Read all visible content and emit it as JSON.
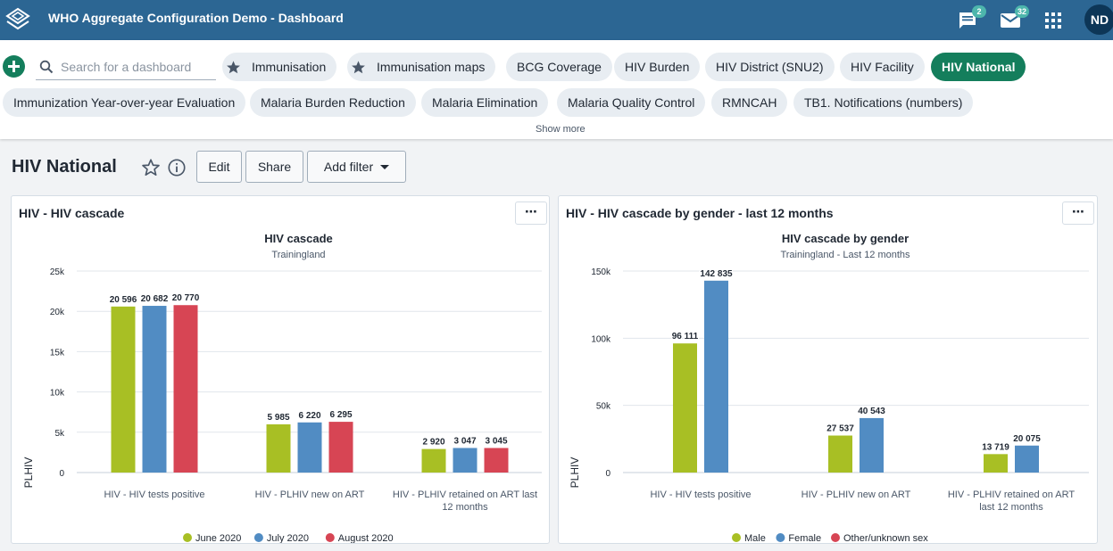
{
  "app": {
    "title": "WHO Aggregate Configuration Demo - Dashboard",
    "logo_icon": "dhis2-logo-icon",
    "interpretations_badge": "2",
    "messages_badge": "32",
    "user_initials": "ND",
    "colors": {
      "header": "#2c6693",
      "accent": "#147e5c",
      "badge": "#4db6ac"
    }
  },
  "dashboards": {
    "search_placeholder": "Search for a dashboard",
    "items": [
      {
        "label": "Immunisation",
        "starred": true
      },
      {
        "label": "Immunisation maps",
        "starred": true
      },
      {
        "label": "BCG Coverage",
        "starred": false
      },
      {
        "label": "HIV Burden",
        "starred": false
      },
      {
        "label": "HIV District (SNU2)",
        "starred": false
      },
      {
        "label": "HIV Facility",
        "starred": false
      },
      {
        "label": "HIV National",
        "starred": false,
        "selected": true
      },
      {
        "label": "Immunization Year-over-year Evaluation",
        "starred": false
      },
      {
        "label": "Malaria Burden Reduction",
        "starred": false
      },
      {
        "label": "Malaria Elimination",
        "starred": false
      },
      {
        "label": "Malaria Quality Control",
        "starred": false
      },
      {
        "label": "RMNCAH",
        "starred": false
      },
      {
        "label": "TB1. Notifications (numbers)",
        "starred": false
      }
    ],
    "show_more": "Show more"
  },
  "dashboard": {
    "title": "HIV National",
    "edit_label": "Edit",
    "share_label": "Share",
    "add_filter_label": "Add filter"
  },
  "panels": [
    {
      "title": "HIV - HIV cascade",
      "menu_label": "⋯"
    },
    {
      "title": "HIV - HIV cascade by gender - last 12 months",
      "menu_label": "⋯"
    }
  ],
  "chart_data": [
    {
      "type": "bar",
      "title": "HIV cascade",
      "subtitle": "Trainingland",
      "xlabel": "",
      "ylabel": "PLHIV",
      "ylim": [
        0,
        25000
      ],
      "yticks": [
        "0",
        "5k",
        "10k",
        "15k",
        "20k",
        "25k"
      ],
      "categories": [
        "HIV - HIV tests positive",
        "HIV - PLHIV new on ART",
        "HIV - PLHIV retained on ART last 12 months"
      ],
      "series": [
        {
          "name": "June 2020",
          "color": "#a8bf24",
          "values": [
            20596,
            5985,
            2920
          ],
          "labels": [
            "20 596",
            "5 985",
            "2 920"
          ]
        },
        {
          "name": "July 2020",
          "color": "#518cc3",
          "values": [
            20682,
            6220,
            3047
          ],
          "labels": [
            "20 682",
            "6 220",
            "3 047"
          ]
        },
        {
          "name": "August 2020",
          "color": "#d74554",
          "values": [
            20770,
            6295,
            3045
          ],
          "labels": [
            "20 770",
            "6 295",
            "3 045"
          ]
        }
      ],
      "grid": true,
      "legend": "bottom-center"
    },
    {
      "type": "bar",
      "title": "HIV cascade by gender",
      "subtitle": "Trainingland - Last 12 months",
      "xlabel": "",
      "ylabel": "PLHIV",
      "ylim": [
        0,
        150000
      ],
      "yticks": [
        "0",
        "50k",
        "100k",
        "150k"
      ],
      "categories": [
        "HIV - HIV tests positive",
        "HIV - PLHIV new on ART",
        "HIV - PLHIV retained on ART last 12 months"
      ],
      "series": [
        {
          "name": "Male",
          "color": "#a8bf24",
          "values": [
            96111,
            27537,
            13719
          ],
          "labels": [
            "96 111",
            "27 537",
            "13 719"
          ]
        },
        {
          "name": "Female",
          "color": "#518cc3",
          "values": [
            142835,
            40543,
            20075
          ],
          "labels": [
            "142 835",
            "40 543",
            "20 075"
          ]
        },
        {
          "name": "Other/unknown sex",
          "color": "#d74554",
          "values": [
            null,
            null,
            null
          ],
          "labels": [
            "",
            "",
            ""
          ]
        }
      ],
      "grid": true,
      "legend": "bottom-center"
    }
  ]
}
